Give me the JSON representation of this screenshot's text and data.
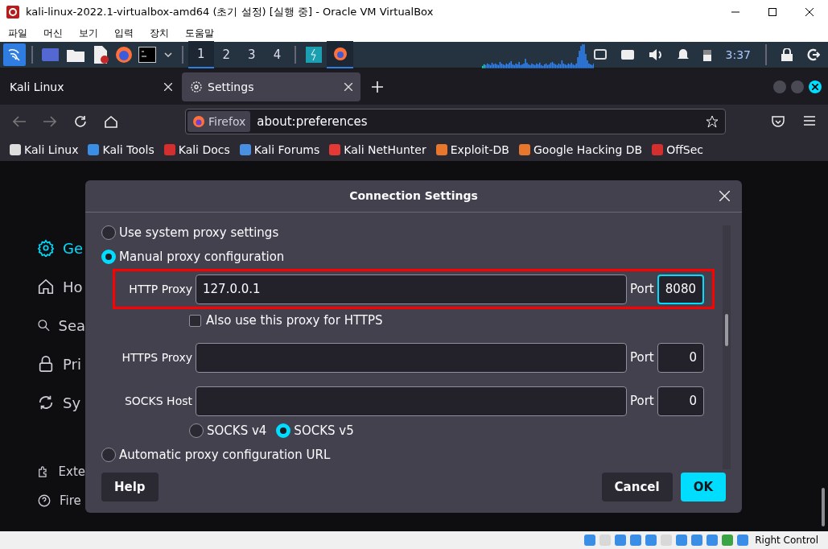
{
  "vbox_window": {
    "title": "kali-linux-2022.1-virtualbox-amd64 (초기 설정) [실행 중] - Oracle VM VirtualBox",
    "menu": [
      "파일",
      "머신",
      "보기",
      "입력",
      "장치",
      "도움말"
    ]
  },
  "kali_panel": {
    "workspaces": [
      {
        "label": "1",
        "selected": true
      },
      {
        "label": "2",
        "selected": false
      },
      {
        "label": "3",
        "selected": false
      },
      {
        "label": "4",
        "selected": false
      }
    ],
    "clock": "3:37"
  },
  "browser": {
    "tabs": [
      {
        "label": "Kali Linux",
        "selected": false
      },
      {
        "label": "Settings",
        "selected": true
      }
    ],
    "identity": "Firefox",
    "url": "about:preferences",
    "bookmarks": [
      {
        "label": "Kali Linux",
        "color": "#dddddd"
      },
      {
        "label": "Kali Tools",
        "color": "#3a8ee6"
      },
      {
        "label": "Kali Docs",
        "color": "#d32f2f"
      },
      {
        "label": "Kali Forums",
        "color": "#4a90e2"
      },
      {
        "label": "Kali NetHunter",
        "color": "#e53935"
      },
      {
        "label": "Exploit-DB",
        "color": "#e8772e"
      },
      {
        "label": "Google Hacking DB",
        "color": "#e8772e"
      },
      {
        "label": "OffSec",
        "color": "#d32f2f"
      }
    ]
  },
  "sidebar": [
    {
      "kind": "gear",
      "label": "Ge",
      "selected": true
    },
    {
      "kind": "home",
      "label": "Ho",
      "selected": false
    },
    {
      "kind": "search",
      "label": "Sea",
      "selected": false
    },
    {
      "kind": "lock",
      "label": "Pri",
      "selected": false
    },
    {
      "kind": "sync",
      "label": "Sy",
      "selected": false
    },
    {
      "kind": "extension",
      "label": "Exte",
      "selected": false
    },
    {
      "kind": "help",
      "label": "Fire",
      "selected": false
    }
  ],
  "dialog": {
    "title": "Connection Settings",
    "content": [
      {
        "kind": "radio",
        "label": "Use system proxy settings",
        "selected": false
      },
      {
        "kind": "radio",
        "label": "Manual proxy configuration",
        "selected": true
      },
      {
        "kind": "proxy",
        "label": "HTTP Proxy",
        "value": "127.0.0.1",
        "port_label": "Port",
        "port": "8080",
        "focused": true,
        "highlighted": true
      },
      {
        "kind": "checkbox",
        "label": "Also use this proxy for HTTPS",
        "checked": false
      },
      {
        "kind": "proxy",
        "label": "HTTPS Proxy",
        "port_label": "Port",
        "port": "0",
        "focused": false,
        "highlighted": false
      },
      {
        "kind": "proxy",
        "label": "SOCKS Host",
        "port_label": "Port",
        "port": "0",
        "focused": false,
        "highlighted": false
      },
      {
        "kind": "socks",
        "options": [
          {
            "label": "SOCKS v4",
            "selected": false
          },
          {
            "label": "SOCKS v5",
            "selected": true
          }
        ]
      },
      {
        "kind": "radio",
        "label": "Automatic proxy configuration URL",
        "selected": false
      }
    ],
    "buttons": [
      {
        "label": "Help",
        "kind": "secondary"
      },
      {
        "label": "Cancel",
        "kind": "secondary"
      },
      {
        "label": "OK",
        "kind": "primary"
      }
    ]
  },
  "status_bar": {
    "host_key": "Right Control"
  }
}
